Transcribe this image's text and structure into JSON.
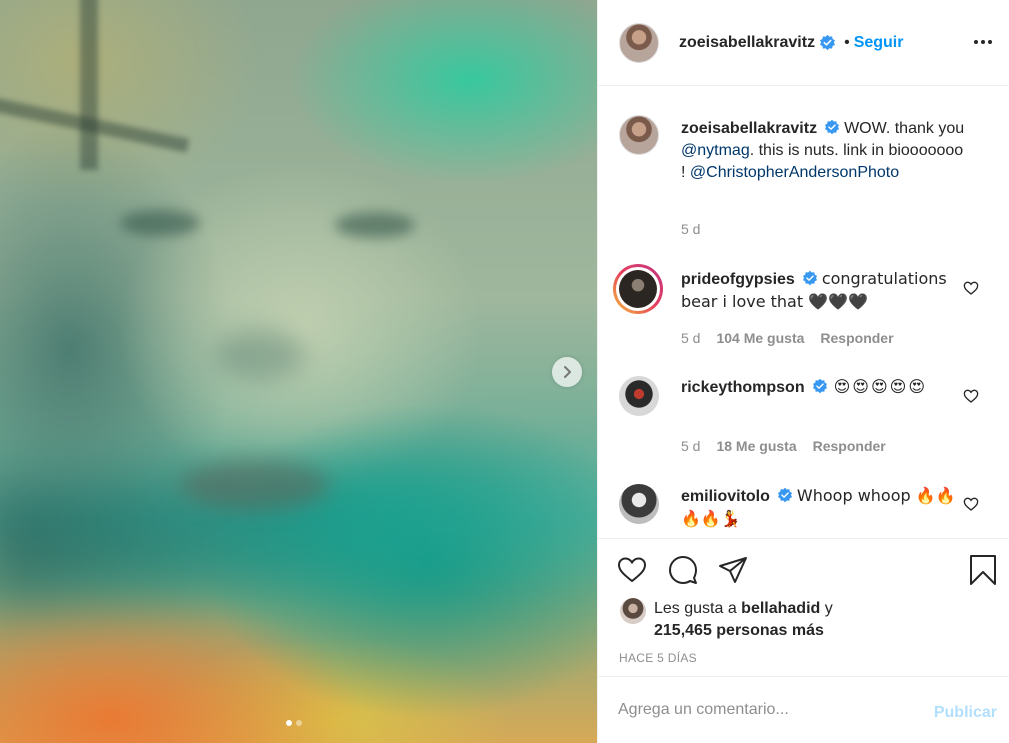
{
  "post": {
    "author": "zoeisabellakravitz",
    "follow_separator": "•",
    "follow_label": "Seguir",
    "carousel": {
      "slide_count": 2,
      "active_slide": 1
    }
  },
  "caption": {
    "username": "zoeisabellakravitz",
    "text_1": "WOW. thank you ",
    "mention_1": "@nytmag",
    "text_2": ". this is nuts. link in biooooooo ! ",
    "mention_2": "@ChristopherAndersonPhoto",
    "time": "5 d"
  },
  "comments": [
    {
      "username": "prideofgypsies",
      "text": "congratulations bear i love that 🖤🖤🖤",
      "time": "5 d",
      "likes": "104 Me gusta",
      "reply": "Responder"
    },
    {
      "username": "rickeythompson",
      "text": "😍😍😍😍😍",
      "time": "5 d",
      "likes": "18 Me gusta",
      "reply": "Responder"
    },
    {
      "username": "emiliovitolo",
      "text": "Whoop whoop 🔥🔥🔥🔥💃"
    }
  ],
  "likes": {
    "prefix": "Les gusta a ",
    "liker": "bellahadid",
    "suffix": " y",
    "count_text": "215,465 personas más"
  },
  "time_ago": "HACE 5 DÍAS",
  "add_comment": {
    "placeholder": "Agrega un comentario...",
    "publish_label": "Publicar"
  },
  "colors": {
    "accent": "#0095f6",
    "publish_disabled": "#b2dffc",
    "mention": "#00376b",
    "muted": "#8e8e8e",
    "verified": "#3897f0"
  }
}
